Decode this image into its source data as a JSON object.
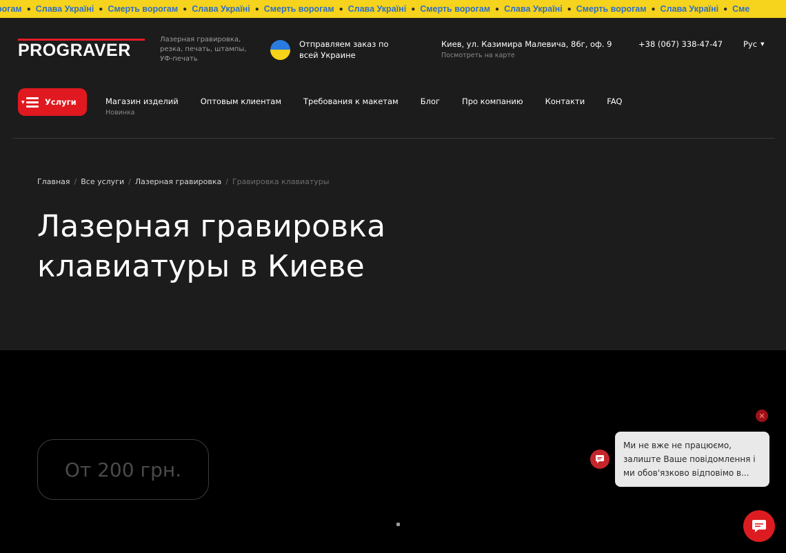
{
  "ticker": {
    "items": [
      "рогам",
      "Слава Україні",
      "Смерть ворогам",
      "Слава Україні",
      "Смерть ворогам",
      "Слава Україні",
      "Смерть ворогам",
      "Слава Україні",
      "Смерть ворогам",
      "Слава Україні",
      "Сме"
    ],
    "text_color": "#2f6fc7",
    "background": "#f6d31c"
  },
  "header": {
    "logo_text": "PROGRAVER",
    "tagline": "Лазерная гравировка, резка, печать, штампы, УФ-печать",
    "shipping": "Отправляем заказ по всей Украине",
    "address": "Киев, ул. Казимира Малевича, 86г, оф. 9",
    "map_link": "Посмотреть на карте",
    "phone": "+38 (067) 338-47-47",
    "language": "Рус"
  },
  "nav": {
    "services_label": "Услуги",
    "items": [
      {
        "label": "Магазин изделий",
        "sub": "Новинка"
      },
      {
        "label": "Оптовым клиентам"
      },
      {
        "label": "Требования к макетам"
      },
      {
        "label": "Блог"
      },
      {
        "label": "Про компанию"
      },
      {
        "label": "Контакти"
      },
      {
        "label": "FAQ"
      }
    ]
  },
  "breadcrumb": {
    "items": [
      "Главная",
      "Все услуги",
      "Лазерная гравировка"
    ],
    "current": "Гравировка клавиатуры"
  },
  "page": {
    "title": "Лазерная гравировка клавиатуры в Киеве",
    "price": "От 200 грн."
  },
  "chat": {
    "message": "Ми не вже не працюємо, залиште Ваше повідомлення і ми обов'язково відповімо в..."
  },
  "colors": {
    "accent": "#e0181f",
    "header_bg": "#1c1c1c",
    "page_bg": "#000000"
  }
}
